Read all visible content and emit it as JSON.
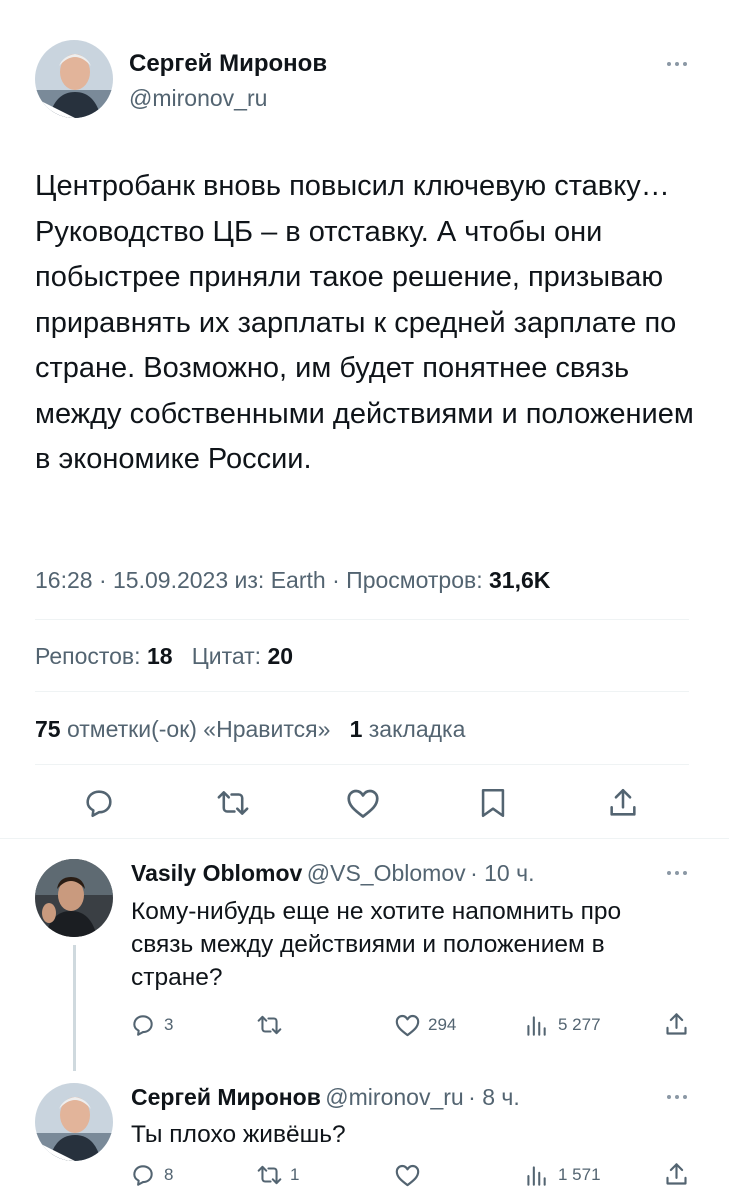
{
  "main_tweet": {
    "author_name": "Сергей Миронов",
    "author_handle": "@mironov_ru",
    "avatar_icon": "user-avatar-icon",
    "text": "Центробанк вновь повысил ключевую ставку… Руководство ЦБ – в отставку. А чтобы они побыстрее приняли такое решение, призываю приравнять их зарплаты к средней зарплате по стране. Возможно, им будет понятнее связь между собственными действиями и положением в экономике России.",
    "time": "16:28",
    "date": "15.09.2023",
    "source_prefix": "из:",
    "source": "Earth",
    "views_label": "Просмотров:",
    "views_value": "31,6K",
    "reposts_label": "Репостов:",
    "reposts_value": "18",
    "quotes_label": "Цитат:",
    "quotes_value": "20",
    "likes_value": "75",
    "likes_label": "отметки(-ок) «Нравится»",
    "bookmarks_value": "1",
    "bookmarks_label": "закладка"
  },
  "replies": [
    {
      "author_name": "Vasily Oblomov",
      "author_handle": "@VS_Oblomov",
      "time": "· 10 ч.",
      "text": "Кому-нибудь еще не хотите напомнить про связь между действиями и положением в стране?",
      "replies": "3",
      "retweets": "",
      "likes": "294",
      "views": "5 277"
    },
    {
      "author_name": "Сергей Миронов",
      "author_handle": "@mironov_ru",
      "time": "· 8 ч.",
      "text": "Ты плохо живёшь?",
      "replies": "8",
      "retweets": "1",
      "likes": "",
      "views": "1 571"
    }
  ],
  "icons": {
    "reply": "reply-icon",
    "retweet": "retweet-icon",
    "like": "heart-icon",
    "bookmark": "bookmark-icon",
    "share": "share-icon",
    "views": "views-icon",
    "more": "more-icon"
  },
  "colors": {
    "text": "#0f1419",
    "muted": "#536471",
    "divider": "#eff3f4"
  }
}
